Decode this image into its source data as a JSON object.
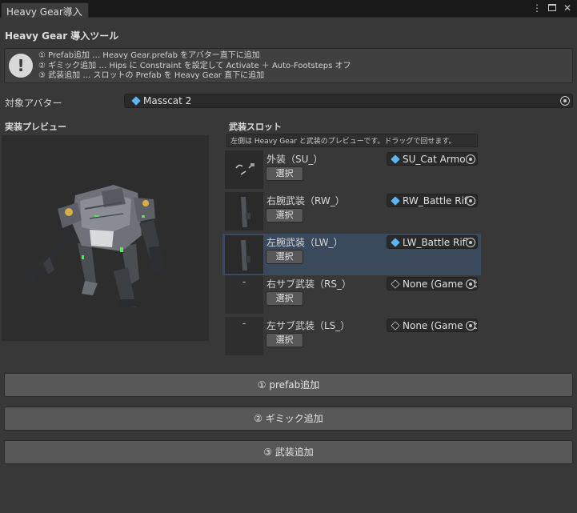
{
  "window": {
    "tab_title": "Heavy Gear導入",
    "menu_icon": "kebab-menu-icon",
    "maximize_icon": "maximize-icon",
    "close_icon": "close-icon"
  },
  "tool": {
    "title": "Heavy Gear 導入ツール",
    "help_icon": "!",
    "help_lines": [
      "① Prefab追加 … Heavy Gear.prefab をアバター直下に追加",
      "② ギミック追加 … Hips に Constraint を設定して Activate ＋ Auto-Footsteps オフ",
      "③ 武装追加 … スロットの Prefab を Heavy Gear 直下に追加"
    ]
  },
  "avatar": {
    "label": "対象アバター",
    "value": "Masscat 2"
  },
  "preview": {
    "heading": "実装プレビュー"
  },
  "slots": {
    "heading": "武装スロット",
    "note": "左側は Heavy Gear と武装のプレビューです。ドラッグで回せます。",
    "select_label": "選択",
    "items": [
      {
        "label": "外装（SU_）",
        "value": "SU_Cat Armor",
        "thumb": "",
        "assigned": true
      },
      {
        "label": "右腕武装（RW_）",
        "value": "RW_Battle Rifle",
        "thumb": "",
        "assigned": true
      },
      {
        "label": "左腕武装（LW_）",
        "value": "LW_Battle Rifle",
        "thumb": "",
        "assigned": true
      },
      {
        "label": "右サブ武装（RS_）",
        "value": "None (Game Object)",
        "thumb": "-",
        "assigned": false
      },
      {
        "label": "左サブ武装（LS_）",
        "value": "None (Game Object)",
        "thumb": "-",
        "assigned": false
      }
    ]
  },
  "actions": {
    "prefab": "① prefab追加",
    "gimmick": "② ギミック追加",
    "weapon": "③ 武装追加"
  },
  "colors": {
    "background": "#383838",
    "selected_row": "#3a4a5c",
    "object_icon": "#5cb5f0"
  }
}
